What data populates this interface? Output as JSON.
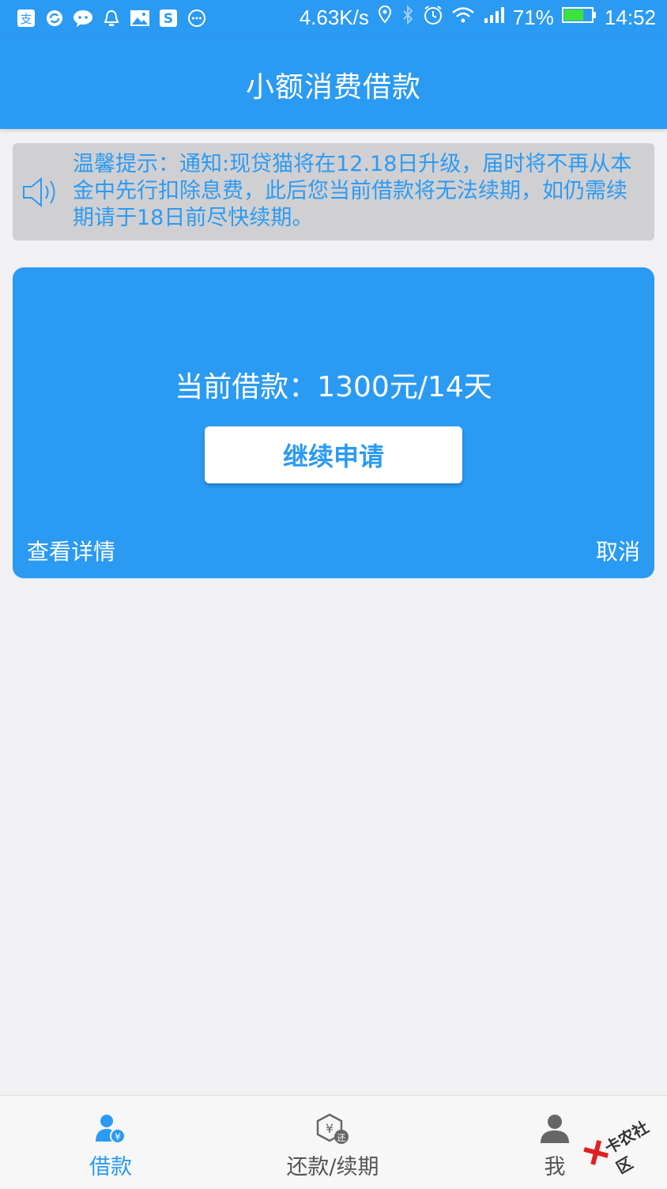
{
  "status_bar": {
    "net_speed": "4.63K/s",
    "battery_percent": "71%",
    "battery_level": 0.71,
    "time": "14:52",
    "left_icons": [
      "alipay-icon",
      "sync-icon",
      "wechat-icon",
      "alarm-bell-icon",
      "gallery-icon",
      "s-app-icon",
      "more-icon"
    ],
    "right_icons": [
      "location-icon",
      "bluetooth-icon",
      "alarm-clock-icon",
      "wifi-icon",
      "signal-icon",
      "battery-icon"
    ]
  },
  "header": {
    "title": "小额消费借款"
  },
  "notice": {
    "icon": "speaker-icon",
    "text": "温馨提示：通知:现贷猫将在12.18日升级，届时将不再从本金中先行扣除息费，此后您当前借款将无法续期，如仍需续期请于18日前尽快续期。"
  },
  "loan_card": {
    "loan_text": "当前借款：1300元/14天",
    "apply_button": "继续申请",
    "details_link": "查看详情",
    "cancel_link": "取消"
  },
  "bottom_nav": {
    "items": [
      {
        "label": "借款",
        "icon": "loan-user-icon",
        "active": true
      },
      {
        "label": "还款/续期",
        "icon": "repay-icon",
        "active": false
      },
      {
        "label": "我",
        "icon": "profile-icon",
        "active": false
      }
    ]
  },
  "watermark": {
    "text": "卡农社区"
  },
  "colors": {
    "primary": "#2b9af3",
    "notice_bg": "#d0d0d2",
    "page_bg": "#f1f0f2"
  }
}
